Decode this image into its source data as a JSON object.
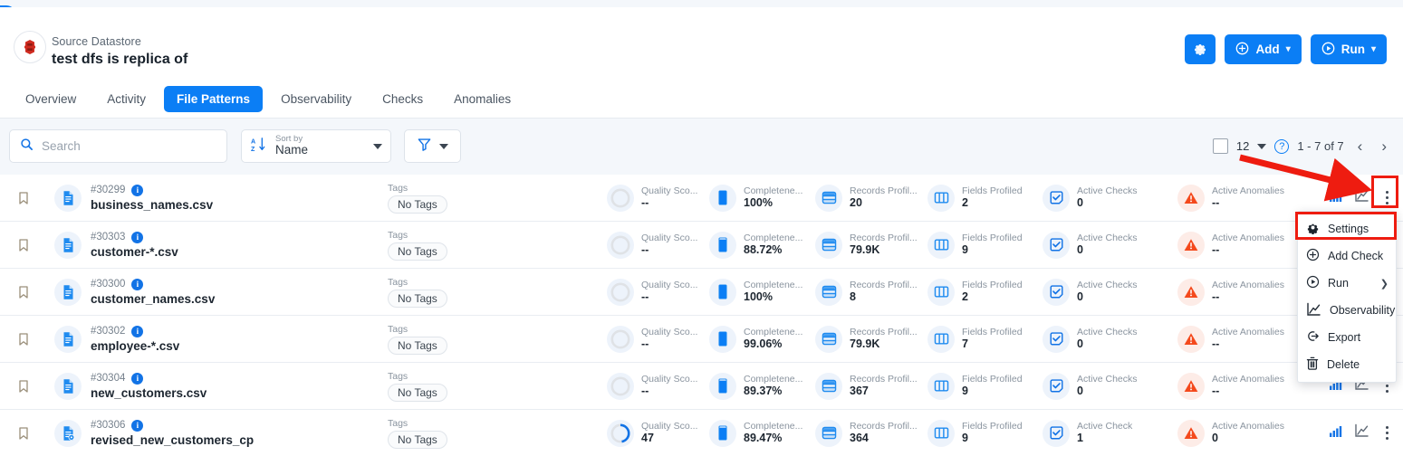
{
  "header": {
    "collapse_icon": "chevron-left-icon",
    "datastore_icon": "datastore-icon",
    "subtitle": "Source Datastore",
    "title": "test dfs is replica of",
    "settings_icon": "gear-icon",
    "add_label": "Add",
    "add_icon": "plus-circle-icon",
    "run_label": "Run",
    "run_icon": "play-circle-icon",
    "caret": "▾",
    "accent_color": "#0b7ef5"
  },
  "tabs": [
    {
      "label": "Overview",
      "active": false
    },
    {
      "label": "Activity",
      "active": false
    },
    {
      "label": "File Patterns",
      "active": true
    },
    {
      "label": "Observability",
      "active": false
    },
    {
      "label": "Checks",
      "active": false
    },
    {
      "label": "Anomalies",
      "active": false
    }
  ],
  "toolbar": {
    "search_placeholder": "Search",
    "search_value": "",
    "search_icon": "search-icon",
    "sort_label": "Sort by",
    "sort_value": "Name",
    "sort_icon": "sort-az-icon",
    "filter_icon": "filter-icon",
    "page_size": "12",
    "help_icon": "question-circle-icon",
    "range": "1 - 7 of 7",
    "prev_icon": "chevron-left-icon",
    "next_icon": "chevron-right-icon"
  },
  "columns": {
    "tags": "Tags",
    "quality": "Quality Sco...",
    "completeness": "Completene...",
    "records": "Records Profil...",
    "fields": "Fields Profiled",
    "checks": "Active Checks",
    "anomalies": "Active Anomalies"
  },
  "rows": [
    {
      "id": "#30299",
      "name": "business_names.csv",
      "tag": "No Tags",
      "quality_label": "Quality Sco...",
      "quality": "--",
      "quality_pct": 0,
      "completeness_label": "Completene...",
      "completeness": "100%",
      "completeness_fill": 100,
      "records_label": "Records Profil...",
      "records": "20",
      "fields_label": "Fields Profiled",
      "fields": "2",
      "checks_label": "Active Checks",
      "checks": "0",
      "anomalies_label": "Active Anomalies",
      "anomalies": "--",
      "file_icon": "file-csv-icon"
    },
    {
      "id": "#30303",
      "name": "customer-*.csv",
      "tag": "No Tags",
      "quality_label": "Quality Sco...",
      "quality": "--",
      "quality_pct": 0,
      "completeness_label": "Completene...",
      "completeness": "88.72%",
      "completeness_fill": 89,
      "records_label": "Records Profil...",
      "records": "79.9K",
      "fields_label": "Fields Profiled",
      "fields": "9",
      "checks_label": "Active Checks",
      "checks": "0",
      "anomalies_label": "Active Anomalies",
      "anomalies": "--",
      "file_icon": "file-csv-icon"
    },
    {
      "id": "#30300",
      "name": "customer_names.csv",
      "tag": "No Tags",
      "quality_label": "Quality Sco...",
      "quality": "--",
      "quality_pct": 0,
      "completeness_label": "Completene...",
      "completeness": "100%",
      "completeness_fill": 100,
      "records_label": "Records Profil...",
      "records": "8",
      "fields_label": "Fields Profiled",
      "fields": "2",
      "checks_label": "Active Checks",
      "checks": "0",
      "anomalies_label": "Active Anomalies",
      "anomalies": "--",
      "file_icon": "file-csv-icon"
    },
    {
      "id": "#30302",
      "name": "employee-*.csv",
      "tag": "No Tags",
      "quality_label": "Quality Sco...",
      "quality": "--",
      "quality_pct": 0,
      "completeness_label": "Completene...",
      "completeness": "99.06%",
      "completeness_fill": 99,
      "records_label": "Records Profil...",
      "records": "79.9K",
      "fields_label": "Fields Profiled",
      "fields": "7",
      "checks_label": "Active Checks",
      "checks": "0",
      "anomalies_label": "Active Anomalies",
      "anomalies": "--",
      "file_icon": "file-csv-icon"
    },
    {
      "id": "#30304",
      "name": "new_customers.csv",
      "tag": "No Tags",
      "quality_label": "Quality Sco...",
      "quality": "--",
      "quality_pct": 0,
      "completeness_label": "Completene...",
      "completeness": "89.37%",
      "completeness_fill": 89,
      "records_label": "Records Profil...",
      "records": "367",
      "fields_label": "Fields Profiled",
      "fields": "9",
      "checks_label": "Active Checks",
      "checks": "0",
      "anomalies_label": "Active Anomalies",
      "anomalies": "--",
      "file_icon": "file-csv-icon"
    },
    {
      "id": "#30306",
      "name": "revised_new_customers_cp",
      "tag": "No Tags",
      "quality_label": "Quality Sco...",
      "quality": "47",
      "quality_pct": 47,
      "completeness_label": "Completene...",
      "completeness": "89.47%",
      "completeness_fill": 89,
      "records_label": "Records Profil...",
      "records": "364",
      "fields_label": "Fields Profiled",
      "fields": "9",
      "checks_label": "Active Check",
      "checks": "1",
      "anomalies_label": "Active Anomalies",
      "anomalies": "0",
      "file_icon": "file-gear-icon"
    }
  ],
  "row_actions": {
    "bar_chart_icon": "bar-chart-icon",
    "line_chart_icon": "line-chart-icon",
    "kebab_icon": "more-vertical-icon",
    "bookmark_icon": "bookmark-icon"
  },
  "context_menu": [
    {
      "label": "Settings",
      "icon": "gear-icon",
      "submenu": false
    },
    {
      "label": "Add Check",
      "icon": "plus-circle-icon",
      "submenu": false
    },
    {
      "label": "Run",
      "icon": "play-circle-icon",
      "submenu": true
    },
    {
      "label": "Observability",
      "icon": "line-chart-icon",
      "submenu": false
    },
    {
      "label": "Export",
      "icon": "export-icon",
      "submenu": false
    },
    {
      "label": "Delete",
      "icon": "trash-icon",
      "submenu": false
    }
  ],
  "annotation": {
    "color": "#ee1c10"
  }
}
